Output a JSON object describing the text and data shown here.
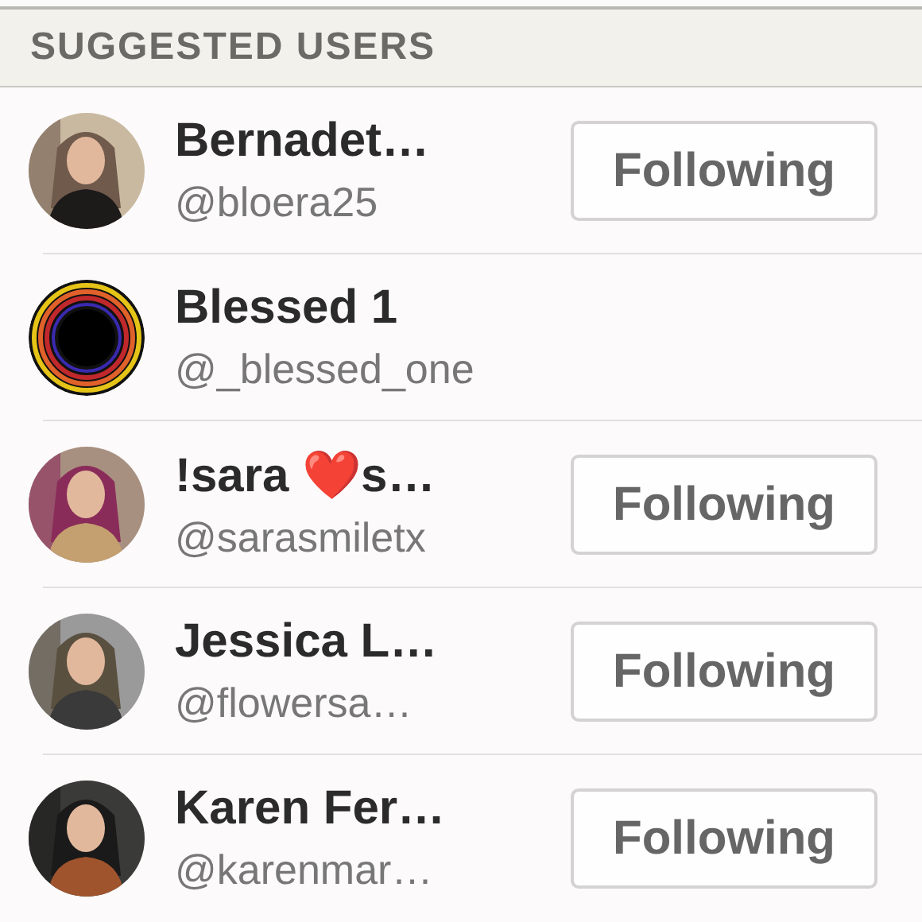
{
  "section": {
    "title": "SUGGESTED USERS"
  },
  "users": [
    {
      "name": "Bernadet…",
      "handle": "@bloera25",
      "button": "Following"
    },
    {
      "name": "Blessed 1",
      "handle": "@_blessed_one"
    },
    {
      "name": "!sara ❤️s…",
      "handle": "@sarasmiletx",
      "button": "Following"
    },
    {
      "name": "Jessica L…",
      "handle": "@flowersa…",
      "button": "Following"
    },
    {
      "name": "Karen Fer…",
      "handle": "@karenmar…",
      "button": "Following"
    }
  ]
}
